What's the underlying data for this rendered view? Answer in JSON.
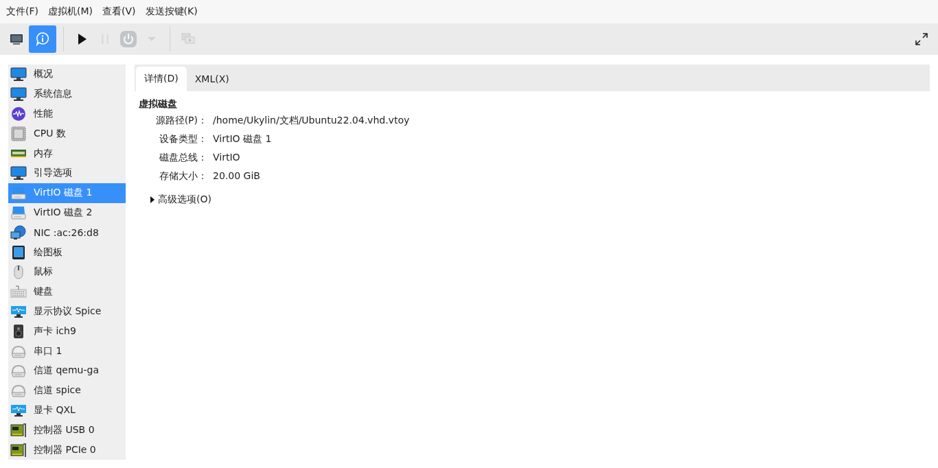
{
  "menu_bar": [
    "文件(F)",
    "虚拟机(M)",
    "查看(V)",
    "发送按键(K)"
  ],
  "toolbar": [
    {
      "kind": "console",
      "selected": false,
      "disabled": false
    },
    {
      "kind": "details",
      "selected": true,
      "disabled": false
    },
    {
      "kind": "separator"
    },
    {
      "kind": "run",
      "selected": false,
      "disabled": false
    },
    {
      "kind": "pause",
      "selected": false,
      "disabled": true
    },
    {
      "kind": "power",
      "selected": false,
      "disabled": true
    },
    {
      "kind": "caret",
      "selected": false,
      "disabled": true
    },
    {
      "kind": "separator"
    },
    {
      "kind": "snapshots",
      "selected": false,
      "disabled": true
    },
    {
      "kind": "spacer"
    },
    {
      "kind": "fullscreen",
      "selected": false,
      "disabled": false
    }
  ],
  "sidebar": {
    "items": [
      {
        "label": "概况",
        "kind": "monitor",
        "selected": false
      },
      {
        "label": "系统信息",
        "kind": "monitor",
        "selected": false
      },
      {
        "label": "性能",
        "kind": "gauge",
        "selected": false
      },
      {
        "label": "CPU 数",
        "kind": "cpu",
        "selected": false
      },
      {
        "label": "内存",
        "kind": "memory",
        "selected": false
      },
      {
        "label": "引导选项",
        "kind": "monitor",
        "selected": false
      },
      {
        "label": "VirtIO 磁盘 1",
        "kind": "disk",
        "selected": true
      },
      {
        "label": "VirtIO 磁盘 2",
        "kind": "disk",
        "selected": false
      },
      {
        "label": "NIC :ac:26:d8",
        "kind": "nic",
        "selected": false
      },
      {
        "label": "绘图板",
        "kind": "tablet",
        "selected": false
      },
      {
        "label": "鼠标",
        "kind": "mouse",
        "selected": false
      },
      {
        "label": "键盘",
        "kind": "keyboard",
        "selected": false
      },
      {
        "label": "显示协议 Spice",
        "kind": "display",
        "selected": false
      },
      {
        "label": "声卡 ich9",
        "kind": "speaker",
        "selected": false
      },
      {
        "label": "串口 1",
        "kind": "serial",
        "selected": false
      },
      {
        "label": "信道 qemu-ga",
        "kind": "serial",
        "selected": false
      },
      {
        "label": "信道 spice",
        "kind": "serial",
        "selected": false
      },
      {
        "label": "显卡 QXL",
        "kind": "display",
        "selected": false
      },
      {
        "label": "控制器 USB 0",
        "kind": "card",
        "selected": false
      },
      {
        "label": "控制器 PCIe 0",
        "kind": "card",
        "selected": false
      }
    ]
  },
  "tabs": [
    {
      "label": "详情(D)",
      "selected": true
    },
    {
      "label": "XML(X)",
      "selected": false
    }
  ],
  "details": {
    "title": "虚拟磁盘",
    "fields": [
      {
        "label": "源路径(P)：",
        "value": "/home/Ukylin/文档/Ubuntu22.04.vhd.vtoy"
      },
      {
        "label": "设备类型：",
        "value": "VirtIO 磁盘 1"
      },
      {
        "label": "磁盘总线：",
        "value": "VirtIO"
      },
      {
        "label": "存储大小：",
        "value": "20.00 GiB"
      }
    ],
    "advanced": {
      "label": "高级选项(O)",
      "expanded": false
    }
  }
}
